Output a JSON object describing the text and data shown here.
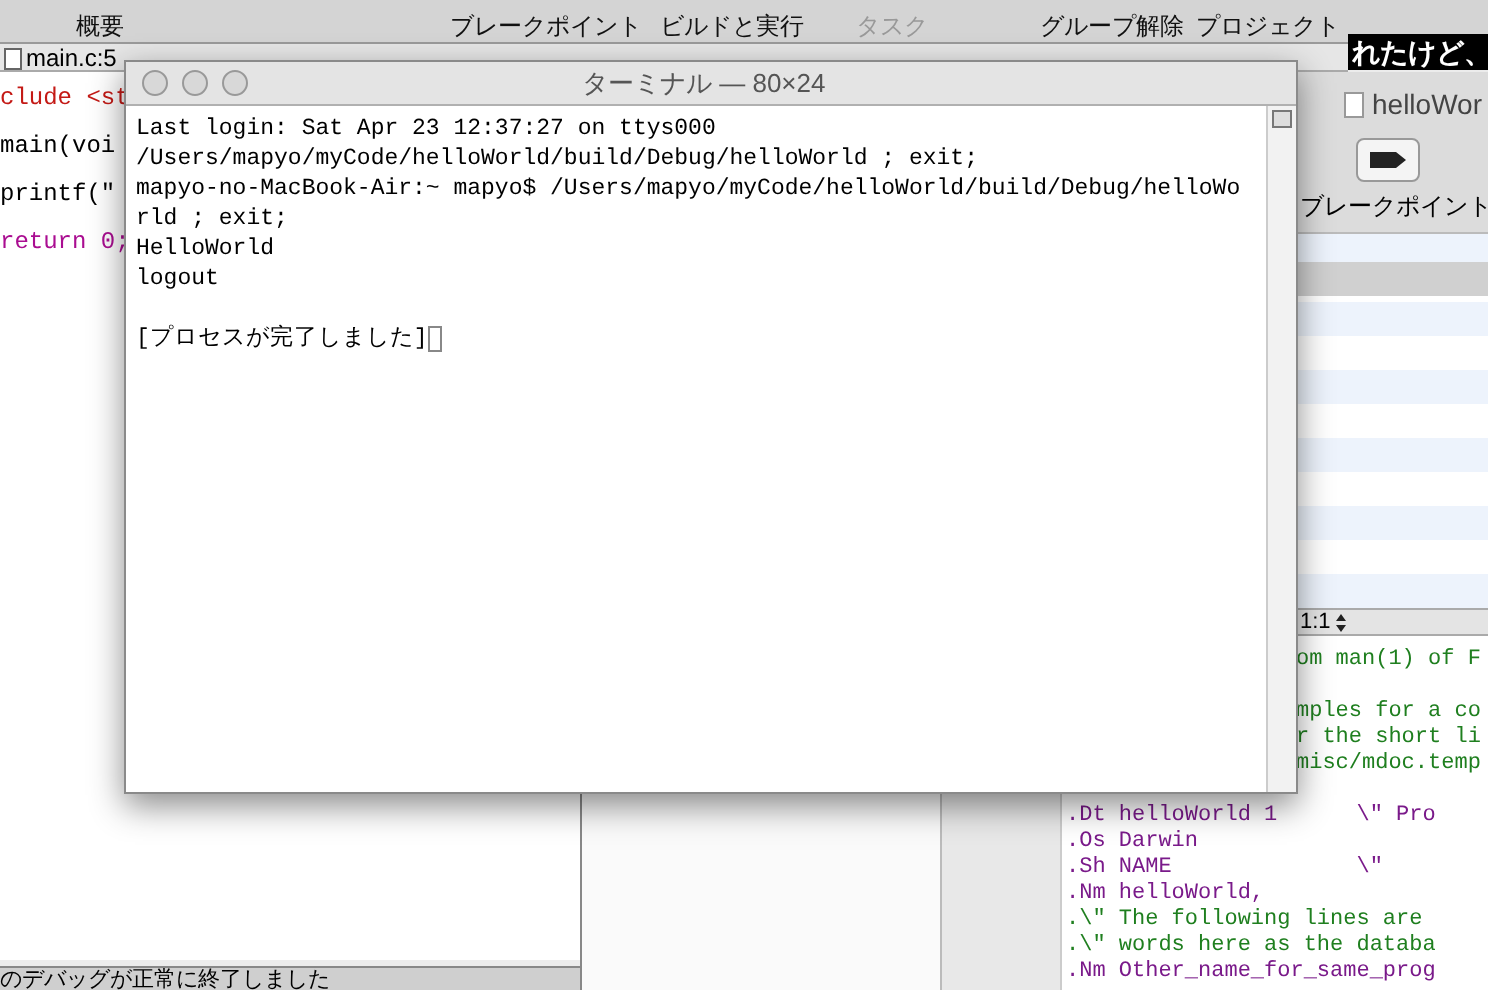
{
  "toolbar": {
    "items": [
      {
        "label": "概要",
        "disabled": false
      },
      {
        "label": "ブレークポイント",
        "disabled": false
      },
      {
        "label": "ビルドと実行",
        "disabled": false
      },
      {
        "label": "タスク",
        "disabled": true
      },
      {
        "label": "グループ解除",
        "disabled": false
      },
      {
        "label": "プロジェクト",
        "disabled": false
      }
    ]
  },
  "overlay_caption": "れたけど、",
  "editor": {
    "file": "main.c:5",
    "lines": [
      {
        "text": "clude <st",
        "kind": "include"
      },
      {
        "text": "main(voi",
        "kind": "plain"
      },
      {
        "text": "printf(\"",
        "kind": "plain"
      },
      {
        "text": "return 0;",
        "kind": "keyword"
      }
    ]
  },
  "status_bar": "のデバッグが正常に終了しました",
  "right_window": {
    "title": "helloWor",
    "button_label": "ブレークポイント",
    "position": "1:1",
    "blocks": [
      [
        {
          "text": "om man(1) of F",
          "kind": "comment"
        }
      ],
      [
        {
          "text": "mples for a co",
          "kind": "comment"
        },
        {
          "text": "r the short li",
          "kind": "comment"
        },
        {
          "text": "misc/mdoc.temp",
          "kind": "comment"
        }
      ],
      [
        {
          "text": ".Dt helloWorld 1      \\\" Pro",
          "kind": "macro"
        },
        {
          "text": ".Os Darwin",
          "kind": "macro"
        },
        {
          "text": ".Sh NAME              \\\"",
          "kind": "macro"
        },
        {
          "text": ".Nm helloWorld,",
          "kind": "macro"
        },
        {
          "text": ".\\\" The following lines are",
          "kind": "comment"
        },
        {
          "text": ".\\\" words here as the databa",
          "kind": "comment"
        },
        {
          "text": ".Nm Other_name_for_same_prog",
          "kind": "macro"
        }
      ]
    ]
  },
  "terminal": {
    "title": "ターミナル — 80×24",
    "blocks": [
      [
        "Last login: Sat Apr 23 12:37:27 on ttys000",
        "/Users/mapyo/myCode/helloWorld/build/Debug/helloWorld ; exit;",
        "mapyo-no-MacBook-Air:~ mapyo$ /Users/mapyo/myCode/helloWorld/build/Debug/helloWo",
        "rld ; exit;",
        "HelloWorld",
        "logout"
      ],
      [
        "[プロセスが完了しました]"
      ]
    ]
  }
}
